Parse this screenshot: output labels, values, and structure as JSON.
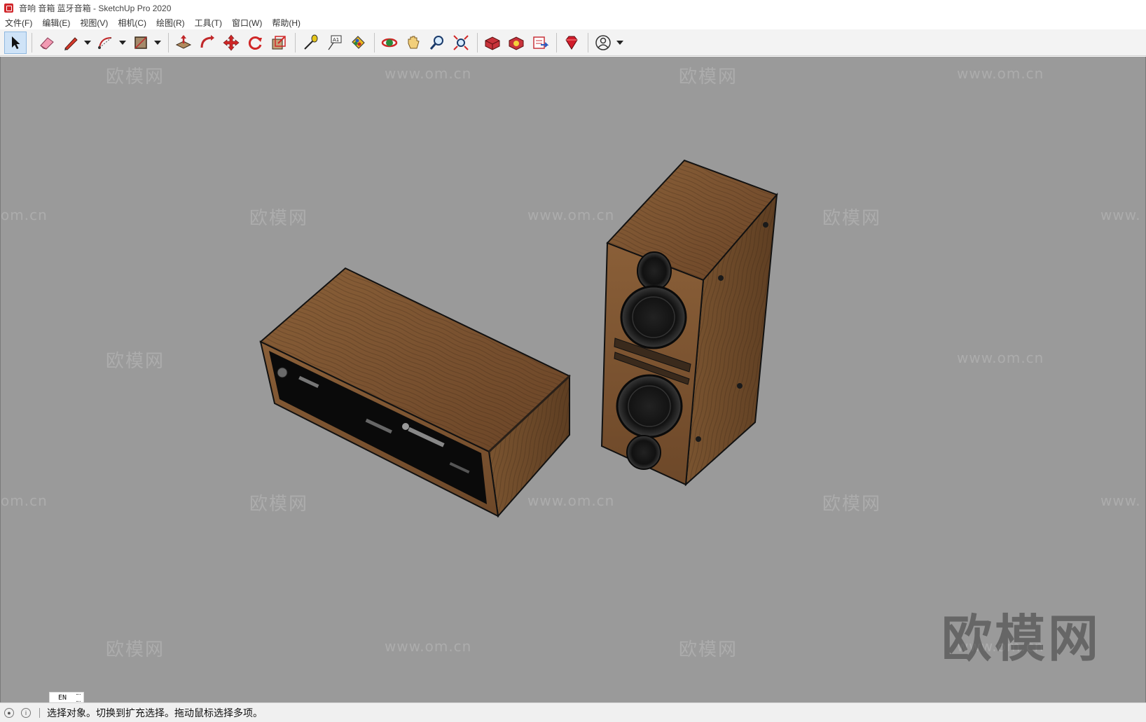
{
  "window": {
    "title": "音响 音箱 蓝牙音箱 - SketchUp Pro 2020"
  },
  "menu": {
    "items": [
      {
        "label": "文件(F)"
      },
      {
        "label": "编辑(E)"
      },
      {
        "label": "视图(V)"
      },
      {
        "label": "相机(C)"
      },
      {
        "label": "绘图(R)"
      },
      {
        "label": "工具(T)"
      },
      {
        "label": "窗口(W)"
      },
      {
        "label": "帮助(H)"
      }
    ]
  },
  "toolbar": {
    "tools": [
      {
        "icon": "select-arrow-icon",
        "active": true
      },
      {
        "icon": "eraser-icon"
      },
      {
        "icon": "pencil-line-icon",
        "dropdown": true
      },
      {
        "icon": "arc-icon",
        "dropdown": true
      },
      {
        "icon": "rectangle-icon",
        "dropdown": true
      },
      {
        "icon": "push-pull-icon"
      },
      {
        "icon": "follow-me-icon"
      },
      {
        "icon": "move-icon"
      },
      {
        "icon": "rotate-icon"
      },
      {
        "icon": "scale-icon"
      },
      {
        "icon": "tape-measure-icon"
      },
      {
        "icon": "text-icon"
      },
      {
        "icon": "paint-bucket-icon"
      },
      {
        "icon": "orbit-icon"
      },
      {
        "icon": "pan-icon"
      },
      {
        "icon": "zoom-icon"
      },
      {
        "icon": "zoom-extents-icon"
      },
      {
        "icon": "3d-warehouse-icon"
      },
      {
        "icon": "extension-warehouse-icon"
      },
      {
        "icon": "layout-send-icon"
      },
      {
        "icon": "ruby-console-icon"
      },
      {
        "icon": "account-icon",
        "dropdown": true
      }
    ],
    "text_tool_label": "A1"
  },
  "viewport": {
    "background": "#9a9a9a",
    "watermark_brand": "欧模网",
    "watermark_url": "www.om.cn",
    "watermark_url_partial_left": "om.cn",
    "watermark_url_partial_right": "www.",
    "watermark_large": "欧模网",
    "wood_color": "#7a5532",
    "wood_dark": "#5a3a20"
  },
  "status": {
    "message": "选择对象。切换到扩充选择。拖动鼠标选择多项。",
    "ime_label": "EN"
  }
}
